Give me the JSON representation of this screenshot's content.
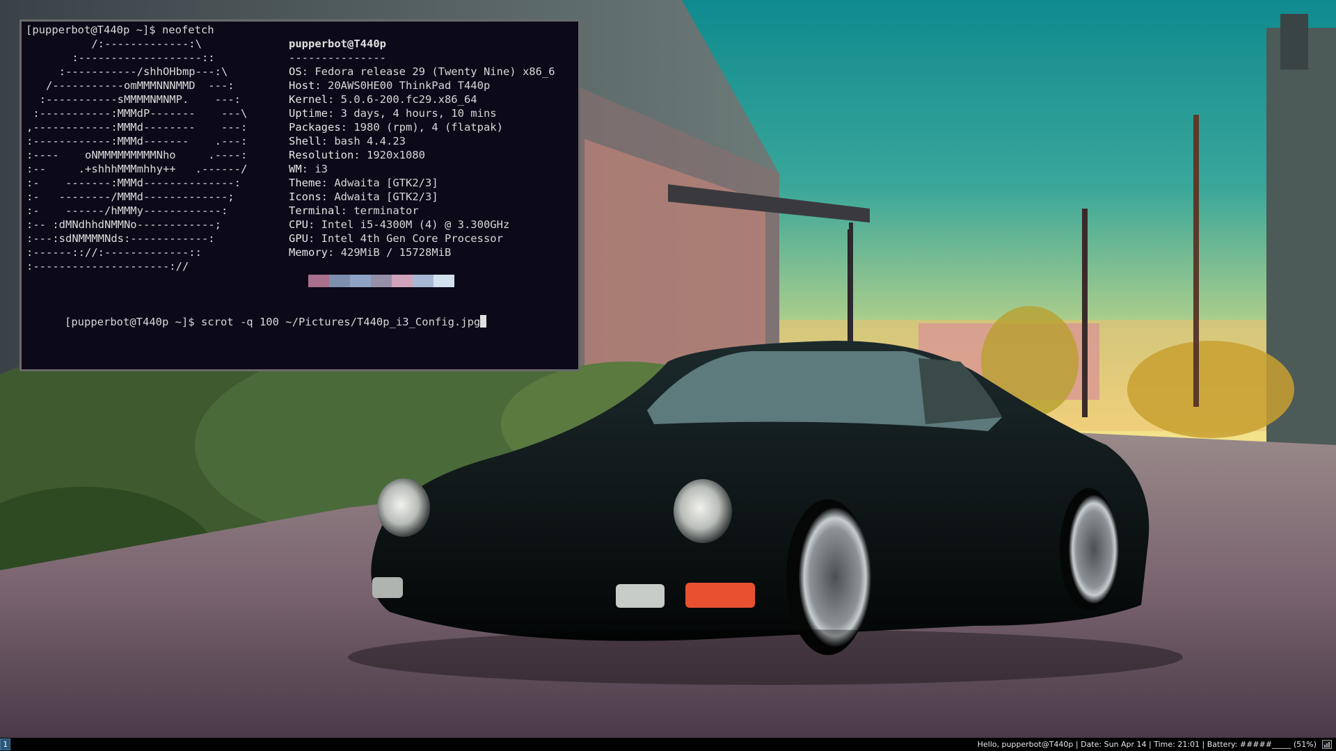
{
  "terminal": {
    "line1": "[pupperbot@T440p ~]$ neofetch",
    "logo": [
      "          /:-------------:\\",
      "       :-------------------::",
      "     :-----------/shhOHbmp---:\\",
      "   /-----------omMMMNNNMMD  ---:",
      "  :-----------sMMMMNMNMP.    ---:",
      " :-----------:MMMdP-------    ---\\",
      ",------------:MMMd--------    ---:",
      ":------------:MMMd-------    .---:",
      ":----    oNMMMMMMMMMNho     .----:",
      ":--     .+shhhMMMmhhy++   .------/",
      ":-    -------:MMMd--------------:",
      ":-   --------/MMMd-------------;",
      ":-    ------/hMMMy------------:",
      ":-- :dMNdhhdNMMNo------------;",
      ":---:sdNMMMMNds:------------:",
      ":------:://:-------------::",
      ":---------------------://"
    ],
    "user_host": "pupperbot@T440p",
    "underline": "---------------",
    "info": [
      {
        "key": "OS",
        "value": "Fedora release 29 (Twenty Nine) x86_6"
      },
      {
        "key": "Host",
        "value": "20AWS0HE00 ThinkPad T440p"
      },
      {
        "key": "Kernel",
        "value": "5.0.6-200.fc29.x86_64"
      },
      {
        "key": "Uptime",
        "value": "3 days, 4 hours, 10 mins"
      },
      {
        "key": "Packages",
        "value": "1980 (rpm), 4 (flatpak)"
      },
      {
        "key": "Shell",
        "value": "bash 4.4.23"
      },
      {
        "key": "Resolution",
        "value": "1920x1080"
      },
      {
        "key": "WM",
        "value": "i3"
      },
      {
        "key": "Theme",
        "value": "Adwaita [GTK2/3]"
      },
      {
        "key": "Icons",
        "value": "Adwaita [GTK2/3]"
      },
      {
        "key": "Terminal",
        "value": "terminator"
      },
      {
        "key": "CPU",
        "value": "Intel i5-4300M (4) @ 3.300GHz"
      },
      {
        "key": "GPU",
        "value": "Intel 4th Gen Core Processor"
      },
      {
        "key": "Memory",
        "value": "429MiB / 15728MiB"
      }
    ],
    "palette": [
      "#a8708c",
      "#7e8fae",
      "#8ea3c6",
      "#9590a8",
      "#d1a3bb",
      "#a6b8d4",
      "#d3e0ee"
    ],
    "prompt2": "[pupperbot@T440p ~]$ scrot -q 100 ~/Pictures/T440p_i3_Config.jpg"
  },
  "statusbar": {
    "workspace": "1",
    "text": "Hello, pupperbot@T440p | Date: Sun Apr 14 | Time: 21:01 | Battery: #####_____ (51%)"
  }
}
